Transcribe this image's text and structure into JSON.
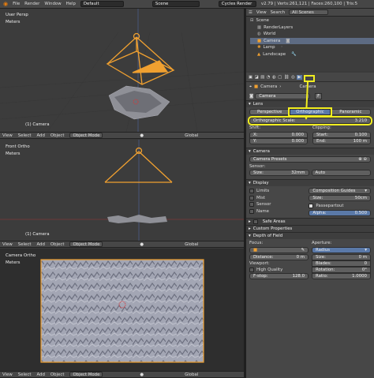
{
  "menubar": {
    "items": [
      "File",
      "Render",
      "Window",
      "Help"
    ],
    "layout": "Default",
    "scene": "Scene",
    "engine": "Cycles Render",
    "stats": "v2.79 | Verts:261,121 | Faces:260,100 | Tris:5"
  },
  "viewport_top": {
    "name": "User Persp",
    "units": "Meters",
    "object": "(1) Camera"
  },
  "viewport_mid": {
    "name": "Front Ortho",
    "units": "Meters",
    "object": "(1) Camera"
  },
  "viewport_bot": {
    "name": "Camera Ortho",
    "units": "Meters"
  },
  "vheader": {
    "view": "View",
    "select": "Select",
    "add": "Add",
    "object": "Object",
    "mode": "Object Mode",
    "orientation": "Global"
  },
  "outliner": {
    "view": "View",
    "search": "Search",
    "filter": "All Scenes",
    "items": [
      "Scene",
      "RenderLayers",
      "World",
      "Camera",
      "Lamp",
      "Landscape"
    ]
  },
  "props": {
    "breadcrumb_a": "Camera",
    "breadcrumb_b": "Camera",
    "datablock": "Camera",
    "fake": "F",
    "lens_title": "Lens",
    "tabs": [
      "Perspective",
      "Orthographic",
      "Panoramic"
    ],
    "ortho_label": "Orthographic Scale:",
    "ortho_value": "3.210",
    "shift": "Shift:",
    "x": "X:",
    "x_val": "0.000",
    "y": "Y:",
    "y_val": "0.000",
    "clipping": "Clipping:",
    "start": "Start:",
    "start_val": "0.100",
    "end": "End:",
    "end_val": "100 m",
    "camera_title": "Camera",
    "presets": "Camera Presets",
    "sensor": "Sensor:",
    "size": "Size:",
    "size_val": "32mm",
    "auto": "Auto",
    "display_title": "Display",
    "limits": "Limits",
    "mist": "Mist",
    "sensor_cb": "Sensor",
    "name": "Name",
    "guides": "Composition Guides",
    "size2": "Size:",
    "size2_val": "50cm",
    "passepartout": "Passepartout",
    "alpha": "Alpha:",
    "alpha_val": "0.500",
    "safe_areas": "Safe Areas",
    "custom_props": "Custom Properties",
    "dof": "Depth of Field",
    "focus": "Focus:",
    "distance": "Distance:",
    "distance_val": "0 m",
    "aperture": "Aperture:",
    "radius": "Radius",
    "size3": "Size:",
    "size3_val": "0 m",
    "viewport": "Viewport:",
    "hq": "High Quality",
    "blades": "Blades:",
    "blades_val": "0",
    "rotation": "Rotation:",
    "rotation_val": "0°",
    "fstop": "F-stop:",
    "fstop_val": "128.0",
    "ratio": "Ratio:",
    "ratio_val": "1.0000"
  },
  "colors": {
    "highlight": "#f2ee20",
    "camera_orange": "#f0a030",
    "accent_blue": "#5a79a8"
  }
}
